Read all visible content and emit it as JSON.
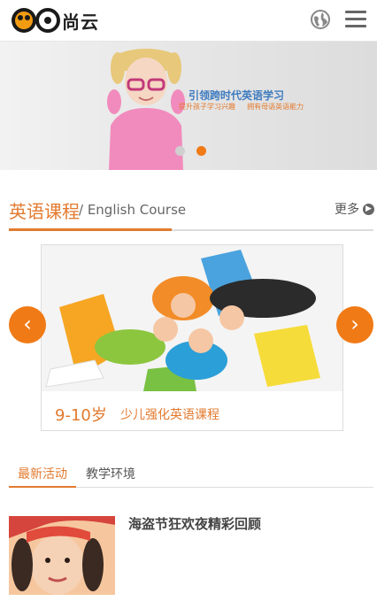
{
  "header": {
    "logo_text": "尚云",
    "globe_icon": "globe-icon",
    "menu_icon": "hamburger-menu-icon"
  },
  "banner": {
    "tagline": "引领跨时代英语学习",
    "sub_left": "提升孩子学习兴趣",
    "sub_right": "拥有母语英语能力",
    "slide_count": 2,
    "active_slide": 2
  },
  "section": {
    "title": "英语课程",
    "subtitle": "/ English Course",
    "more_label": "更多",
    "more_icon": "arrow-right-circle-icon"
  },
  "course_card": {
    "age": "9-10岁",
    "name": "少儿强化英语课程",
    "prev_icon": "chevron-left-icon",
    "next_icon": "chevron-right-icon"
  },
  "tabs": [
    {
      "label": "最新活动",
      "active": true
    },
    {
      "label": "教学环境",
      "active": false
    }
  ],
  "news": [
    {
      "title": "海盗节狂欢夜精彩回顾"
    }
  ],
  "colors": {
    "accent": "#e27a2f",
    "arrow_bg": "#f07a16",
    "banner_blue": "#3e7bbf"
  }
}
